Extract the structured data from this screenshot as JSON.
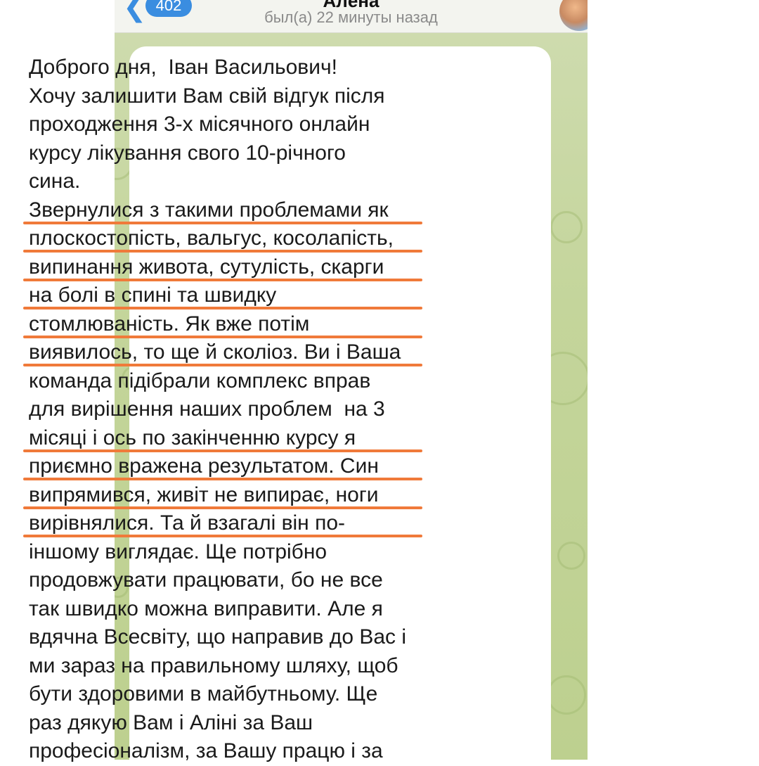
{
  "header": {
    "back_count": "402",
    "contact_name": "Алёна",
    "status": "был(а) 22 минуты назад"
  },
  "message": {
    "lines": [
      "Доброго дня,  Іван Васильович!",
      "Хочу залишити Вам свій відгук після",
      "проходження 3-х місячного онлайн",
      "курсу лікування свого 10-річного",
      "сина.",
      "Звернулися з такими проблемами як",
      "плоскостопість, вальгус, косолапість,",
      "випинання живота, сутулість, скарги",
      "на болі в спині та швидку",
      "стомлюваність. Як вже потім",
      "виявилось, то ще й сколіоз. Ви і Ваша",
      "команда підібрали комплекс вправ",
      "для вирішення наших проблем  на 3",
      "місяці і ось по закінченню курсу я",
      "приємно вражена результатом. Син",
      "випрямився, живіт не випирає, ноги",
      "вирівнялися. Та й взагалі він по-",
      "іншому виглядає. Ще потрібно",
      "продовжувати працювати, бо не все",
      "так швидко можна виправити. Але я",
      "вдячна Всесвіту, що направив до Вас і",
      "ми зараз на правильному шляху, щоб",
      "бути здоровими в майбутньому. Ще",
      "раз дякую Вам і Аліні за Ваш",
      "професіоналізм, за Вашу працю і за"
    ],
    "underlined_line_indices": [
      5,
      6,
      7,
      8,
      9,
      10,
      13,
      14,
      15,
      16
    ]
  },
  "colors": {
    "underline_accent": "#f07a3a",
    "link_blue": "#3a8de0",
    "chat_background": "#c4d59b"
  }
}
